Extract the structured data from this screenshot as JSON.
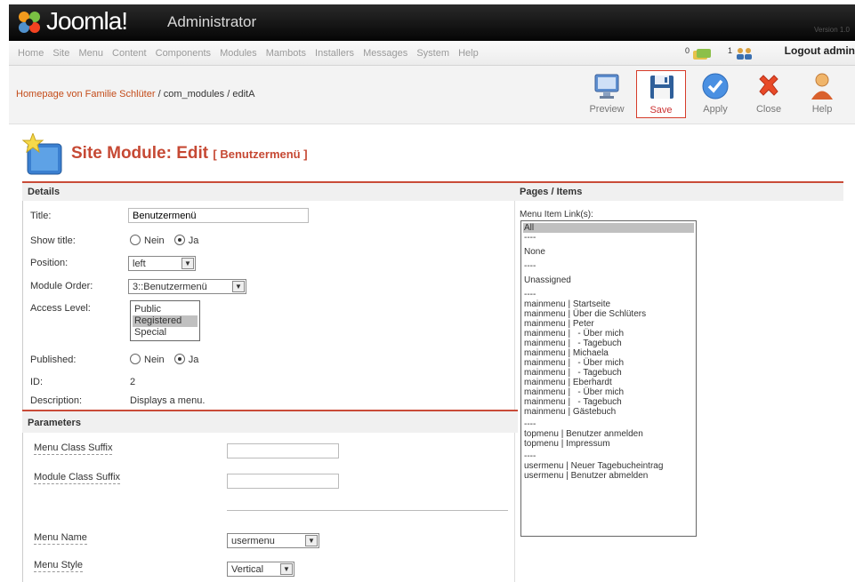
{
  "header": {
    "logo": "Joomla!",
    "product": "Administrator",
    "version": "Version 1.0"
  },
  "menubar": {
    "items": [
      "Home",
      "Site",
      "Menu",
      "Content",
      "Components",
      "Modules",
      "Mambots",
      "Installers",
      "Messages",
      "System",
      "Help"
    ],
    "messages_count": "0",
    "online_count": "1",
    "logout": "Logout admin"
  },
  "breadcrumb": {
    "site": "Homepage von Familie Schlüter",
    "path": " / com_modules / editA"
  },
  "toolbar": {
    "preview": "Preview",
    "save": "Save",
    "apply": "Apply",
    "close": "Close",
    "help": "Help"
  },
  "page": {
    "title": "Site Module: Edit",
    "subtitle": "[ Benutzermenü ]"
  },
  "details": {
    "header": "Details",
    "title_label": "Title:",
    "title_value": "Benutzermenü",
    "show_title_label": "Show title:",
    "no": "Nein",
    "yes": "Ja",
    "position_label": "Position:",
    "position_value": "left",
    "order_label": "Module Order:",
    "order_value": "3::Benutzermenü",
    "access_label": "Access Level:",
    "access_options": [
      "Public",
      "Registered",
      "Special"
    ],
    "access_selected": "Registered",
    "published_label": "Published:",
    "id_label": "ID:",
    "id_value": "2",
    "description_label": "Description:",
    "description_value": "Displays a menu."
  },
  "pages": {
    "header": "Pages / Items",
    "label": "Menu Item Link(s):",
    "items": [
      "All",
      "----",
      "None",
      "----",
      "Unassigned",
      "----",
      "mainmenu | Startseite",
      "mainmenu | Über die Schlüters",
      "mainmenu | Peter",
      "mainmenu |   - Über mich",
      "mainmenu |   - Tagebuch",
      "mainmenu | Michaela",
      "mainmenu |   - Über mich",
      "mainmenu |   - Tagebuch",
      "mainmenu | Eberhardt",
      "mainmenu |   - Über mich",
      "mainmenu |   - Tagebuch",
      "mainmenu | Gästebuch",
      "----",
      "topmenu | Benutzer anmelden",
      "topmenu | Impressum",
      "----",
      "usermenu | Neuer Tagebucheintrag",
      "usermenu | Benutzer abmelden"
    ]
  },
  "parameters": {
    "header": "Parameters",
    "menu_class_suffix": "Menu Class Suffix",
    "module_class_suffix": "Module Class Suffix",
    "menu_name": "Menu Name",
    "menu_name_value": "usermenu",
    "menu_style": "Menu Style",
    "menu_style_value": "Vertical"
  }
}
